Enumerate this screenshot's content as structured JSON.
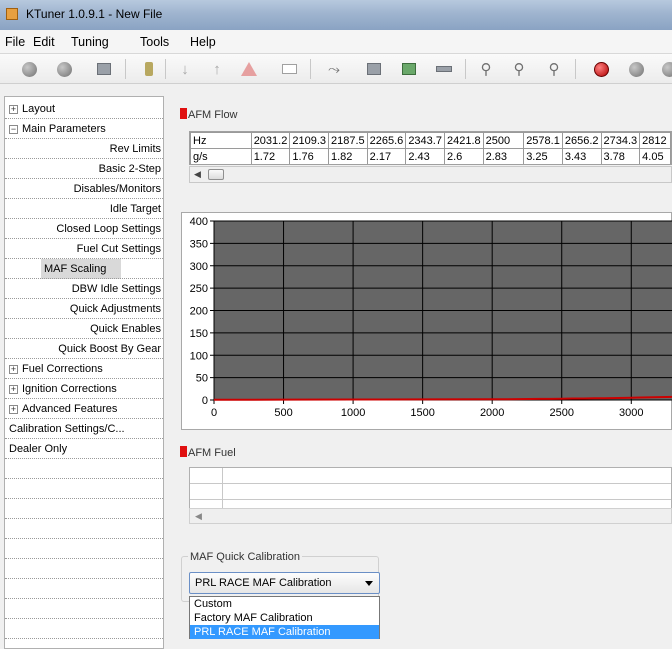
{
  "window": {
    "title": "KTuner 1.0.9.1 - New File"
  },
  "menu": [
    "File",
    "Edit",
    "Tuning",
    "Tools",
    "Help"
  ],
  "sidebar": {
    "items": [
      {
        "label": "Layout",
        "level": 0,
        "expander": "+"
      },
      {
        "label": "Main Parameters",
        "level": 0,
        "expander": "-"
      },
      {
        "label": "Rev Limits",
        "level": 1
      },
      {
        "label": "Basic 2-Step",
        "level": 1
      },
      {
        "label": "Disables/Monitors",
        "level": 1
      },
      {
        "label": "Idle Target",
        "level": 1
      },
      {
        "label": "Closed Loop Settings",
        "level": 1
      },
      {
        "label": "Fuel Cut Settings",
        "level": 1
      },
      {
        "label": "MAF Scaling",
        "level": 1,
        "selected": true
      },
      {
        "label": "DBW Idle Settings",
        "level": 1
      },
      {
        "label": "Quick Adjustments",
        "level": 1
      },
      {
        "label": "Quick Enables",
        "level": 1
      },
      {
        "label": "Quick Boost By Gear",
        "level": 1
      },
      {
        "label": "Fuel Corrections",
        "level": 0,
        "expander": "+"
      },
      {
        "label": "Ignition Corrections",
        "level": 0,
        "expander": "+"
      },
      {
        "label": "Advanced Features",
        "level": 0,
        "expander": "+"
      },
      {
        "label": "Calibration Settings/C...",
        "level": 0
      },
      {
        "label": "Dealer Only",
        "level": 0
      }
    ]
  },
  "afm_flow": {
    "label": "AFM Flow",
    "row_headers": [
      "Hz",
      "g/s"
    ],
    "hz": [
      "2031.2",
      "2109.3",
      "2187.5",
      "2265.6",
      "2343.7",
      "2421.8",
      "2500",
      "2578.1",
      "2656.2",
      "2734.3",
      "2812"
    ],
    "gs": [
      "1.72",
      "1.76",
      "1.82",
      "2.17",
      "2.43",
      "2.6",
      "2.83",
      "3.25",
      "3.43",
      "3.78",
      "4.05"
    ]
  },
  "chart_data": {
    "type": "line",
    "x_ticks": [
      "0",
      "500",
      "1000",
      "1500",
      "2000",
      "2500",
      "3000"
    ],
    "y_ticks": [
      "0",
      "50",
      "100",
      "150",
      "200",
      "250",
      "300",
      "350",
      "400"
    ],
    "xlim": [
      0,
      3300
    ],
    "ylim": [
      0,
      400
    ],
    "series": [
      {
        "color": "#cc0000",
        "x": [
          0,
          500,
          1000,
          1500,
          2000,
          2031.2,
          2109.3,
          2187.5,
          2265.6,
          2343.7,
          2421.8,
          2500,
          2578.1,
          2656.2,
          2734.3,
          2812,
          3000,
          3300
        ],
        "y": [
          0.5,
          0.8,
          1.0,
          1.3,
          1.7,
          1.72,
          1.76,
          1.82,
          2.17,
          2.43,
          2.6,
          2.83,
          3.25,
          3.43,
          3.78,
          4.05,
          5.0,
          7.0
        ]
      }
    ],
    "plot_bg": "#666666",
    "grid": true
  },
  "afm_fuel": {
    "label": "AFM Fuel"
  },
  "maf_quick": {
    "label": "MAF Quick Calibration",
    "selected": "PRL RACE MAF Calibration",
    "options": [
      "Custom",
      "Factory MAF Calibration",
      "PRL RACE MAF Calibration"
    ]
  },
  "toolbar_icons": [
    "grey-circle-icon",
    "globe-icon",
    "chip-icon",
    "plug-icon",
    "down-arrow-icon",
    "up-arrow-icon",
    "warning-icon",
    "rectangle-icon",
    "graph-icon",
    "save-icon",
    "save-green-icon",
    "car-icon",
    "zoom-icon",
    "zoom-in-icon",
    "zoom-out-icon",
    "record-icon",
    "stop-icon"
  ]
}
